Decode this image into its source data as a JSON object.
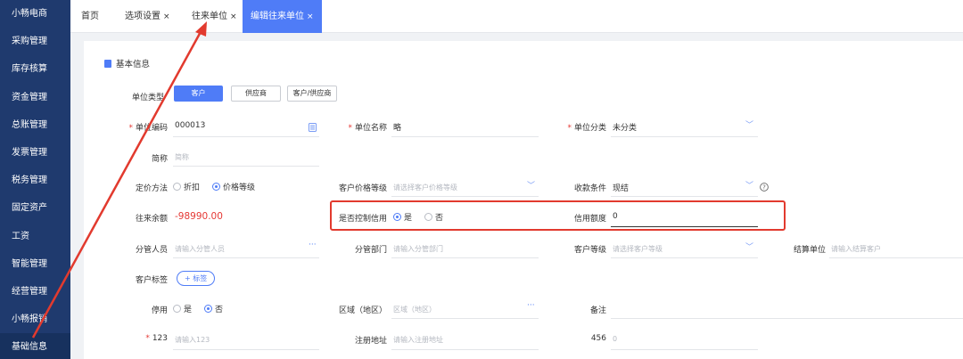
{
  "sidebar": {
    "items": [
      "小畅电商",
      "采购管理",
      "库存核算",
      "资金管理",
      "总账管理",
      "发票管理",
      "税务管理",
      "固定资产",
      "工资",
      "智能管理",
      "经营管理",
      "小畅报销",
      "基础信息"
    ]
  },
  "tabs": {
    "home": "首页",
    "options": "选项设置",
    "partners": "往来单位",
    "edit": "编辑往来单位",
    "close": "×"
  },
  "section": {
    "title": "基本信息"
  },
  "form": {
    "unit_type": {
      "label": "单位类型",
      "options": [
        "客户",
        "供应商",
        "客户/供应商"
      ],
      "selected": "客户"
    },
    "unit_code": {
      "label": "单位编码",
      "value": "000013"
    },
    "unit_name": {
      "label": "单位名称",
      "value": "略"
    },
    "unit_category": {
      "label": "单位分类",
      "value": "未分类"
    },
    "short_name": {
      "label": "简称",
      "placeholder": "简称"
    },
    "pricing_method": {
      "label": "定价方法",
      "options": [
        "折扣",
        "价格等级"
      ],
      "selected": "价格等级"
    },
    "customer_price_level": {
      "label": "客户价格等级",
      "placeholder": "请选择客户价格等级"
    },
    "payment_terms": {
      "label": "收款条件",
      "value": "现结"
    },
    "balance": {
      "label": "往来余额",
      "value": "-98990.00"
    },
    "credit_control": {
      "label": "是否控制信用",
      "options": [
        "是",
        "否"
      ],
      "selected": "是"
    },
    "credit_limit": {
      "label": "信用额度",
      "value": "0"
    },
    "manager": {
      "label": "分管人员",
      "placeholder": "请输入分管人员"
    },
    "department": {
      "label": "分管部门",
      "placeholder": "请输入分管部门"
    },
    "customer_level": {
      "label": "客户等级",
      "placeholder": "请选择客户等级"
    },
    "settlement_unit": {
      "label": "结算单位",
      "placeholder": "请输入结算客户"
    },
    "customer_tags": {
      "label": "客户标签",
      "button": "+ 标签"
    },
    "disabled": {
      "label": "停用",
      "options": [
        "是",
        "否"
      ],
      "selected": "否"
    },
    "region": {
      "label": "区域（地区）",
      "placeholder": "区域（地区）"
    },
    "remark": {
      "label": "备注"
    },
    "field_123": {
      "label": "123",
      "placeholder": "请输入123"
    },
    "reg_address": {
      "label": "注册地址",
      "placeholder": "请输入注册地址"
    },
    "field_456": {
      "label": "456",
      "placeholder": "0"
    }
  },
  "colors": {
    "sidebar": "#1f3a6e",
    "accent": "#4f7cf7",
    "highlight": "#e23a2e",
    "negative": "#e53935"
  },
  "icons": [
    "document-icon",
    "calculator-icon",
    "chevron-down-icon",
    "help-circle-icon",
    "ellipsis-icon"
  ]
}
